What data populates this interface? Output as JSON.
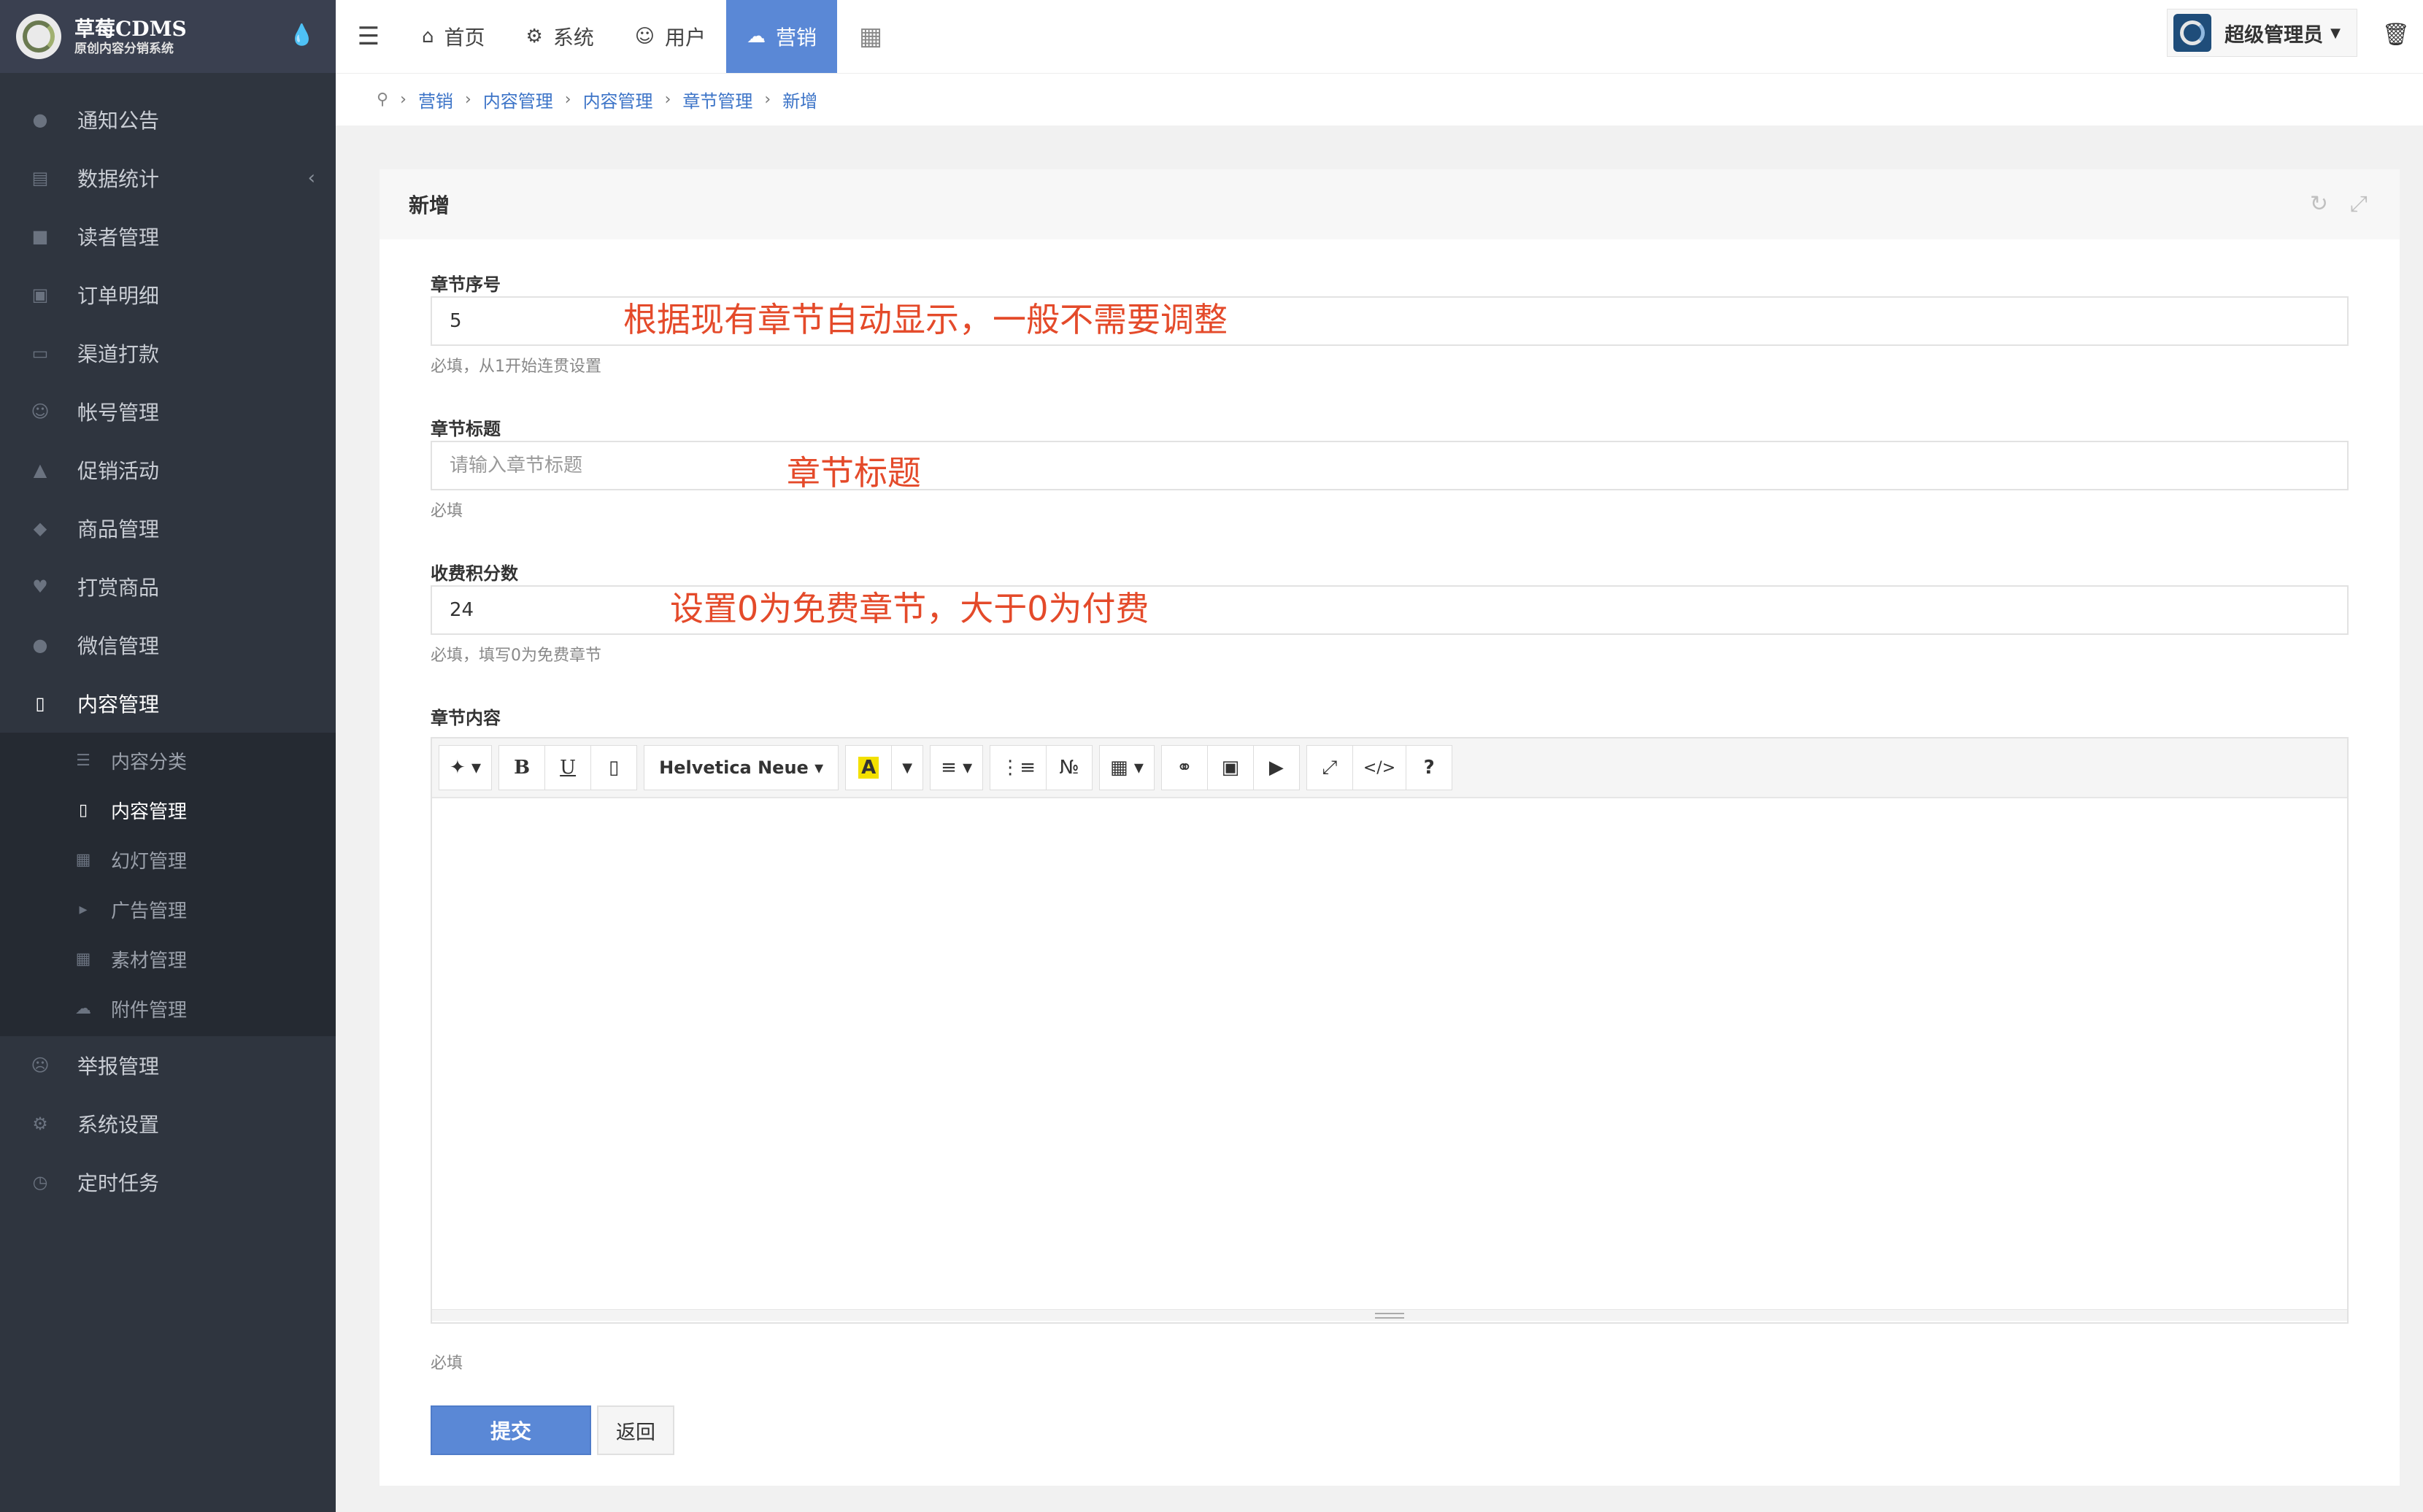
{
  "brand": {
    "title": "草莓CDMS",
    "subtitle": "原创内容分销系统"
  },
  "sidebar": {
    "items": [
      {
        "label": "通知公告",
        "icon": "comment-icon"
      },
      {
        "label": "数据统计",
        "icon": "bar-chart-icon"
      },
      {
        "label": "读者管理",
        "icon": "user-lock-icon"
      },
      {
        "label": "订单明细",
        "icon": "cart-icon"
      },
      {
        "label": "渠道打款",
        "icon": "visa-card-icon"
      },
      {
        "label": "帐号管理",
        "icon": "user-icon"
      },
      {
        "label": "促销活动",
        "icon": "bag-icon"
      },
      {
        "label": "商品管理",
        "icon": "diamond-icon"
      },
      {
        "label": "打赏商品",
        "icon": "heart-icon"
      },
      {
        "label": "微信管理",
        "icon": "wechat-icon"
      },
      {
        "label": "内容管理",
        "icon": "book-icon"
      }
    ],
    "submenu": [
      {
        "label": "内容分类",
        "icon": "list-icon"
      },
      {
        "label": "内容管理",
        "icon": "book-icon"
      },
      {
        "label": "幻灯管理",
        "icon": "image-icon"
      },
      {
        "label": "广告管理",
        "icon": "bullhorn-icon"
      },
      {
        "label": "素材管理",
        "icon": "image-icon"
      },
      {
        "label": "附件管理",
        "icon": "cloud-icon"
      }
    ],
    "bottom_items": [
      {
        "label": "举报管理",
        "icon": "frown-icon"
      },
      {
        "label": "系统设置",
        "icon": "gear-icon"
      },
      {
        "label": "定时任务",
        "icon": "clock-icon"
      }
    ]
  },
  "topbar": {
    "tabs": [
      {
        "label": "首页",
        "icon": "home-icon"
      },
      {
        "label": "系统",
        "icon": "gear-icon"
      },
      {
        "label": "用户",
        "icon": "user-icon"
      },
      {
        "label": "营销",
        "icon": "cloud-icon"
      }
    ],
    "active_tab": "营销",
    "admin_name": "超级管理员"
  },
  "breadcrumb": [
    "营销",
    "内容管理",
    "内容管理",
    "章节管理",
    "新增"
  ],
  "panel": {
    "title": "新增"
  },
  "form": {
    "chapter_no": {
      "label": "章节序号",
      "value": "5",
      "help": "必填，从1开始连贯设置"
    },
    "chapter_title": {
      "label": "章节标题",
      "value": "",
      "placeholder": "请输入章节标题",
      "help": "必填"
    },
    "points": {
      "label": "收费积分数",
      "value": "24",
      "help": "必填，填写0为免费章节"
    },
    "content": {
      "label": "章节内容",
      "help": "必填"
    }
  },
  "editor": {
    "font_name": "Helvetica Neue"
  },
  "annotations": {
    "a1": "根据现有章节自动显示，一般不需要调整",
    "a2": "章节标题",
    "a3": "设置0为免费章节，大于0为付费"
  },
  "buttons": {
    "submit": "提交",
    "back": "返回"
  },
  "colors": {
    "accent": "#5a88d6",
    "sidebar_bg": "#2f353f",
    "annotation": "#e44a2a",
    "link": "#3b73c7"
  }
}
